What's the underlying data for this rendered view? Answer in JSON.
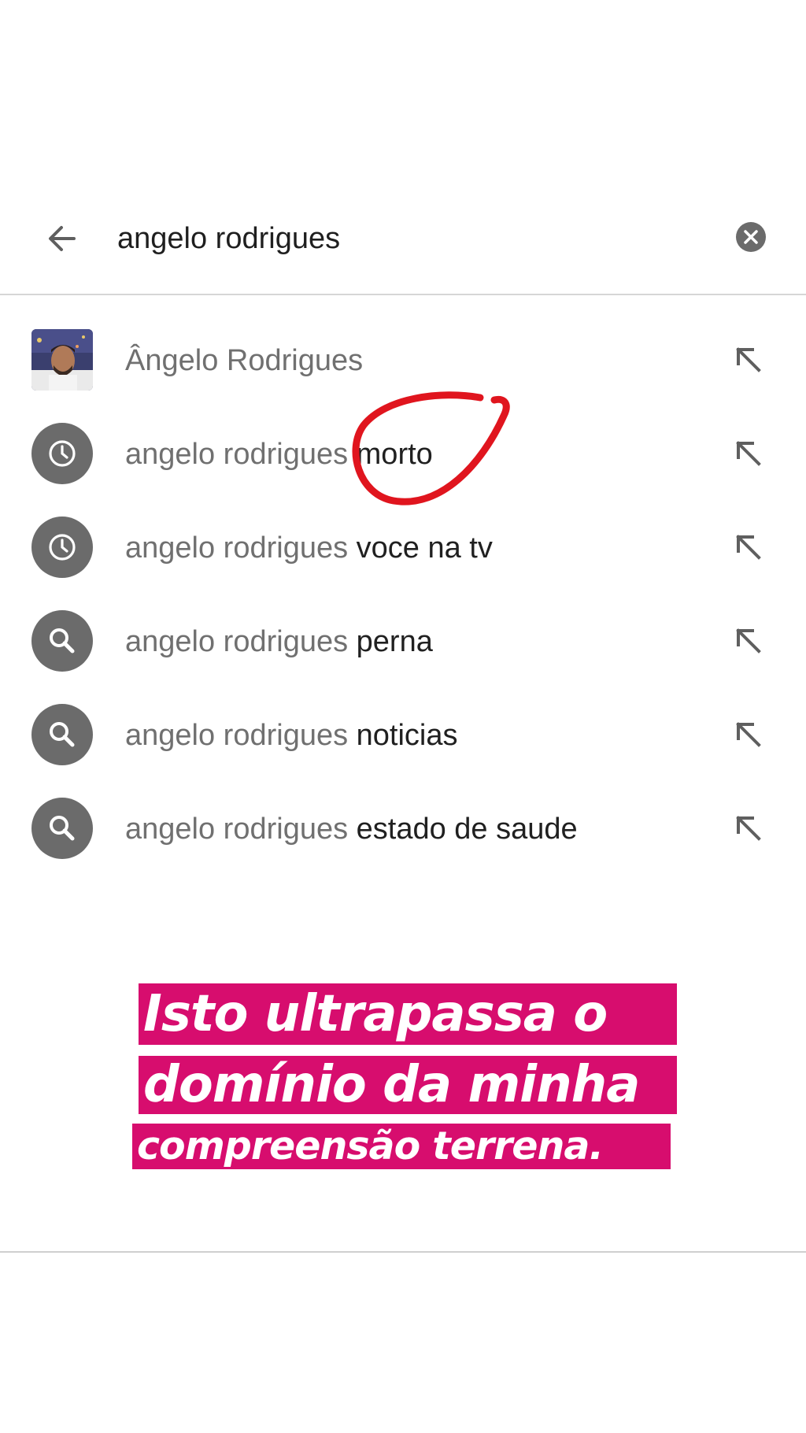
{
  "search": {
    "query": "angelo rodrigues",
    "back_icon": "arrow-left-icon",
    "clear_icon": "clear-circle-icon"
  },
  "suggestions": [
    {
      "type": "profile",
      "icon": "avatar",
      "prefix": "Ângelo Rodrigues",
      "suffix": ""
    },
    {
      "type": "history",
      "icon": "clock-icon",
      "prefix": "angelo rodrigues",
      "suffix": " morto"
    },
    {
      "type": "history",
      "icon": "clock-icon",
      "prefix": "angelo rodrigues",
      "suffix": " voce na tv"
    },
    {
      "type": "search",
      "icon": "search-icon",
      "prefix": "angelo rodrigues",
      "suffix": " perna"
    },
    {
      "type": "search",
      "icon": "search-icon",
      "prefix": "angelo rodrigues",
      "suffix": " noticias"
    },
    {
      "type": "search",
      "icon": "search-icon",
      "prefix": "angelo rodrigues",
      "suffix": " estado de saude"
    }
  ],
  "caption": {
    "lines": [
      "Isto ultrapassa o",
      "domínio da minha",
      "compreensão terrena."
    ],
    "background": "#d70d6e",
    "text_color": "#ffffff"
  },
  "annotation": {
    "shape": "red-loop-circle",
    "color": "#e0151e"
  }
}
